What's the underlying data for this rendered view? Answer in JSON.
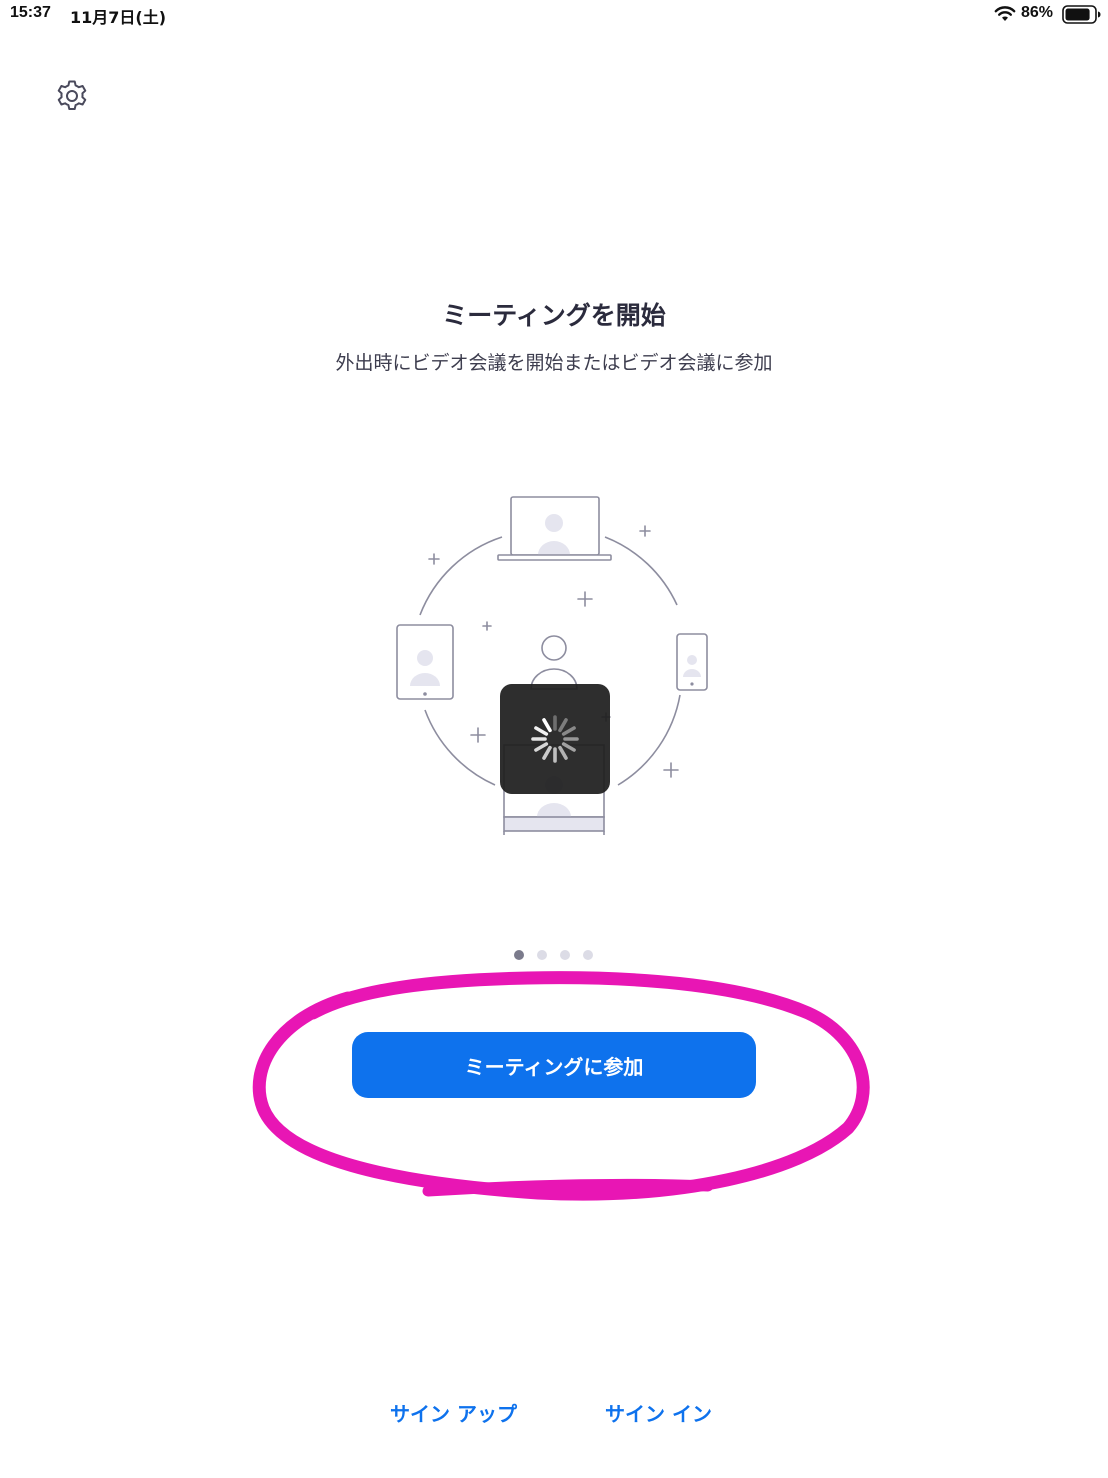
{
  "status_bar": {
    "time": "15:37",
    "date": "11月7日(土)",
    "battery_percent": "86%",
    "battery_level": 0.86,
    "icons": [
      "wifi-icon",
      "battery-icon"
    ]
  },
  "settings": {
    "icon": "gear-icon"
  },
  "onboarding": {
    "title": "ミーティングを開始",
    "subtitle": "外出時にビデオ会議を開始またはビデオ会議に参加",
    "page_count": 4,
    "current_page": 1
  },
  "actions": {
    "join_meeting_label": "ミーティングに参加",
    "sign_up_label": "サイン アップ",
    "sign_in_label": "サイン イン"
  },
  "colors": {
    "primary": "#0e72ed",
    "annotation": "#e816b4",
    "illustration_stroke": "#8d8d9f",
    "illustration_fill": "#e5e5ef"
  }
}
